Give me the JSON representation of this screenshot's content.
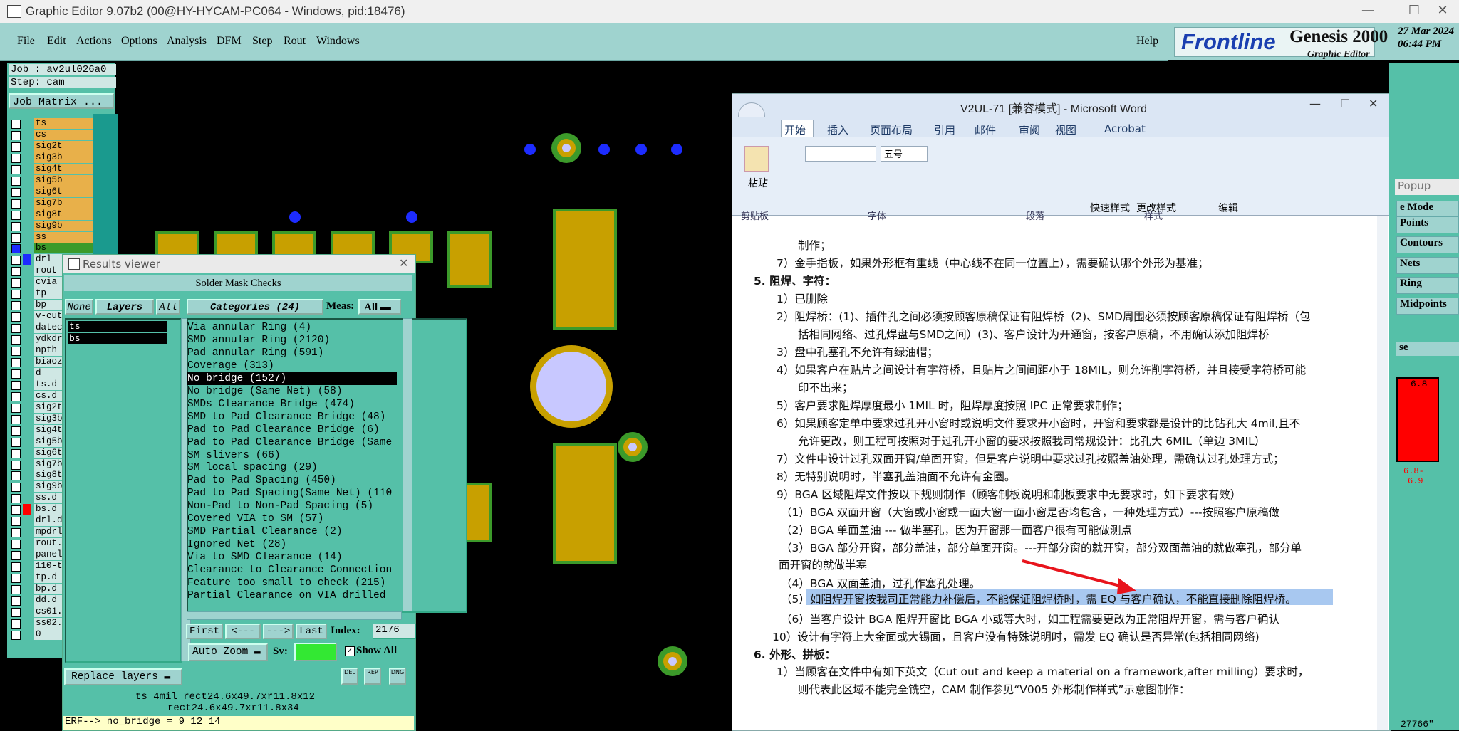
{
  "window": {
    "title": "Graphic Editor 9.07b2 (00@HY-HYCAM-PC064 - Windows, pid:18476)"
  },
  "menu": [
    "File",
    "Edit",
    "Actions",
    "Options",
    "Analysis",
    "DFM",
    "Step",
    "Rout",
    "Windows"
  ],
  "help": "Help",
  "brand": {
    "logo": "Frontline",
    "product": "Genesis 2000",
    "date": "27 Mar 2024",
    "time": "06:44 PM",
    "subtitle": "Graphic Editor"
  },
  "job": {
    "job": "Job : av2ul026a0",
    "step": "Step: cam",
    "matrix_button": "Job Matrix ..."
  },
  "layers": [
    "ts",
    "cs",
    "sig2t",
    "sig3b",
    "sig4t",
    "sig5b",
    "sig6t",
    "sig7b",
    "sig8t",
    "sig9b",
    "ss",
    "bs",
    "drl",
    "rout",
    "cvia",
    "tp",
    "bp",
    "v-cut",
    "datec",
    "ydkdr",
    "npth",
    "biaoz",
    "d",
    "ts.d",
    "cs.d",
    "sig2t",
    "sig3b",
    "sig4t",
    "sig5b",
    "sig6t",
    "sig7b",
    "sig8t",
    "sig9b",
    "ss.d",
    "bs.d",
    "drl.d",
    "mpdrl",
    "rout.",
    "panel",
    "110-t",
    "tp.d",
    "bp.d",
    "dd.d",
    "cs01.",
    "ss02.",
    "0"
  ],
  "results_viewer": {
    "title": "Results viewer",
    "header": "Solder Mask Checks",
    "none_btn": "None",
    "layers_btn": "Layers",
    "all_btn": "All",
    "categories_btn": "Categories (24)",
    "meas_label": "Meas:",
    "meas_value": "All",
    "layer_list": [
      "ts",
      "bs"
    ],
    "categories": [
      "Via annular Ring (4)",
      "SMD annular Ring (2120)",
      "Pad annular Ring (591)",
      "Coverage (313)",
      "No bridge (1527)",
      "No bridge (Same Net) (58)",
      "SMDs Clearance Bridge (474)",
      "SMD to Pad Clearance Bridge (48)",
      "Pad to Pad Clearance Bridge (6)",
      "Pad to Pad Clearance Bridge (Same",
      "SM slivers (66)",
      "SM local spacing (29)",
      "Pad to Pad Spacing (450)",
      "Pad to Pad Spacing(Same Net) (110",
      "Non-Pad to Non-Pad Spacing (5)",
      "Covered VIA to SM (57)",
      "SMD Partial Clearance (2)",
      "Ignored Net (28)",
      "Via to SMD Clearance (14)",
      "Clearance to Clearance Connection",
      "Feature too small to check (215)",
      "Partial Clearance on VIA drilled"
    ],
    "selected_index": 4,
    "nav": [
      "First",
      "<---",
      "--->",
      "Last"
    ],
    "index_label": "Index:",
    "index_value": "2176",
    "auto_zoom": "Auto Zoom",
    "sv_label": "Sv:",
    "show_all": "Show All",
    "replace_layers": "Replace layers",
    "icons": [
      "DEL",
      "REP",
      "DNG"
    ],
    "info1": "ts 4mil  rect24.6x49.7xr11.8x12",
    "info2": "rect24.6x49.7xr11.8x34",
    "erf": "ERF--> no_bridge = 9 12 14"
  },
  "word": {
    "title": "V2UL-71 [兼容模式] - Microsoft Word",
    "tabs": [
      "开始",
      "插入",
      "页面布局",
      "引用",
      "邮件",
      "审阅",
      "视图",
      "Acrobat"
    ],
    "font_size": "五号",
    "groups": [
      "剪贴板",
      "字体",
      "段落",
      "样式"
    ],
    "paste": "粘贴",
    "quick_style": "快速样式",
    "change_style": "更改样式",
    "edit": "编辑",
    "lines": [
      "制作；",
      "7）金手指板，如果外形框有重线（中心线不在同一位置上），需要确认哪个外形为基准；",
      "5.  阻焊、字符：",
      "1）已删除",
      "2）阻焊桥：(1)、插件孔之间必须按顾客原稿保证有阻焊桥（2)、SMD周围必须按顾客原稿保证有阻焊桥（包",
      "括相同网络、过孔焊盘与SMD之间）(3)、客户设计为开通窗，按客户原稿，不用确认添加阻焊桥",
      "3）盘中孔塞孔不允许有绿油帽；",
      "4）如果客户在贴片之间设计有字符桥，且贴片之间间距小于 18MIL，则允许削字符桥，并且接受字符桥可能",
      "印不出来；",
      "5）客户要求阻焊厚度最小 1MIL 时，阻焊厚度按照 IPC 正常要求制作；",
      "6）如果顾客定单中要求过孔开小窗时或说明文件要求开小窗时，开窗和要求都是设计的比钻孔大 4mil,且不",
      "允许更改，则工程可按照对于过孔开小窗的要求按照我司常规设计：比孔大 6MIL（单边 3MIL）",
      "7）文件中设计过孔双面开窗/单面开窗，但是客户说明中要求过孔按照盖油处理，需确认过孔处理方式；",
      "8）无特别说明时，半塞孔盖油面不允许有金圈。",
      "9）BGA 区域阻焊文件按以下规则制作（顾客制板说明和制板要求中无要求时，如下要求有效）",
      "（1）BGA 双面开窗（大窗或小窗或一面大窗一面小窗是否均包含，一种处理方式）---按照客户原稿做",
      "（2）BGA 单面盖油 --- 做半塞孔，因为开窗那一面客户很有可能做测点",
      "（3）BGA 部分开窗，部分盖油，部分单面开窗。---开部分窗的就开窗，部分双面盖油的就做塞孔，部分单",
      "面开窗的就做半塞",
      "（4）BGA 双面盖油，过孔作塞孔处理。",
      "（5）如阻焊开窗按我司正常能力补偿后，不能保证阻焊桥时，需 EQ 与客户确认，不能直接删除阻焊桥。",
      "（6）当客户设计 BGA 阻焊开窗比 BGA 小或等大时，如工程需要更改为正常阻焊开窗，需与客户确认",
      "10）设计有字符上大金面或大锡面，且客户没有特殊说明时，需发 EQ 确认是否异常(包括相同网络)",
      "6.  外形、拼板：",
      "1）当顾客在文件中有如下英文（Cut out and keep a material on a framework,after milling）要求时，",
      "则代表此区域不能完全铣空，CAM 制作参见“V005 外形制作样式”示意图制作："
    ]
  },
  "right_panel": {
    "popup": "Popup",
    "items": [
      "e Mode",
      "Points",
      "Contours",
      "Nets",
      "Ring",
      "Midpoints"
    ],
    "se": "se",
    "val1": "6.8",
    "val2": "6.8-",
    "val3": "6.9",
    "bottom": "27766\""
  },
  "colors": {
    "teal": "#55c0a8",
    "pad": "#c8a000",
    "mask": "#3c9a2a",
    "highlight": "#3399ff"
  }
}
